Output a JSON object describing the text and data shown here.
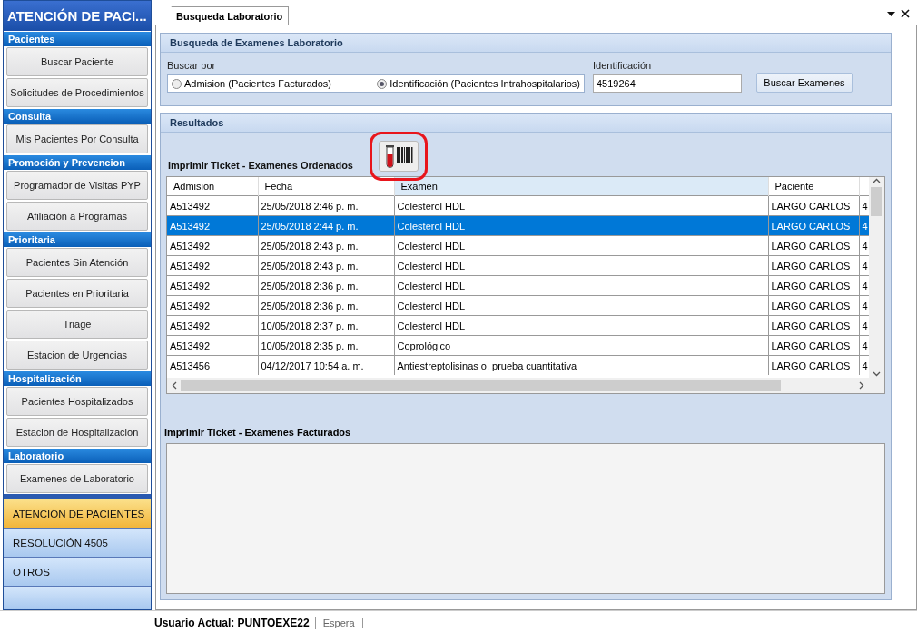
{
  "sidebar": {
    "title": "ATENCIÓN DE PACI...",
    "groups": [
      {
        "header": "Pacientes",
        "items": [
          "Buscar Paciente",
          "Solicitudes de Procedimientos"
        ]
      },
      {
        "header": "Consulta",
        "items": [
          "Mis Pacientes Por Consulta"
        ]
      },
      {
        "header": "Promoción y Prevencion",
        "items": [
          "Programador de Visitas PYP",
          "Afiliación a Programas"
        ]
      },
      {
        "header": "Prioritaria",
        "items": [
          "Pacientes Sin Atención",
          "Pacientes en Prioritaria",
          "Triage",
          "Estacion de Urgencias"
        ]
      },
      {
        "header": "Hospitalización",
        "items": [
          "Pacientes Hospitalizados",
          "Estacion de Hospitalizacion"
        ]
      },
      {
        "header": "Laboratorio",
        "items": [
          "Examenes de Laboratorio"
        ]
      }
    ],
    "modules": [
      {
        "label": "ATENCIÓN DE PACIENTES",
        "selected": true
      },
      {
        "label": "RESOLUCIÓN 4505",
        "selected": false
      },
      {
        "label": "OTROS",
        "selected": false
      }
    ]
  },
  "tabs": [
    {
      "label": "Busqueda Laboratorio",
      "selected": true
    }
  ],
  "search": {
    "title": "Busqueda de Examenes Laboratorio",
    "search_by_label": "Buscar por",
    "options": [
      {
        "label": "Admision (Pacientes Facturados)",
        "selected": false
      },
      {
        "label": "Identificación (Pacientes Intrahospitalarios)",
        "selected": true
      }
    ],
    "id_label": "Identificación",
    "id_value": "4519264",
    "button": "Buscar Examenes"
  },
  "results": {
    "title": "Resultados",
    "ordered_title": "Imprimir Ticket - Examenes Ordenados",
    "table": {
      "columns": [
        "Admision",
        "Fecha",
        "Examen",
        "Paciente"
      ],
      "rows": [
        {
          "cells": [
            "A513492",
            "25/05/2018 2:46 p. m.",
            "Colesterol HDL",
            "LARGO  CARLOS",
            "4"
          ],
          "selected": false
        },
        {
          "cells": [
            "A513492",
            "25/05/2018 2:44 p. m.",
            "Colesterol HDL",
            "LARGO  CARLOS",
            "4"
          ],
          "selected": true
        },
        {
          "cells": [
            "A513492",
            "25/05/2018 2:43 p. m.",
            "Colesterol HDL",
            "LARGO  CARLOS",
            "4"
          ],
          "selected": false
        },
        {
          "cells": [
            "A513492",
            "25/05/2018 2:43 p. m.",
            "Colesterol HDL",
            "LARGO  CARLOS",
            "4"
          ],
          "selected": false
        },
        {
          "cells": [
            "A513492",
            "25/05/2018 2:36 p. m.",
            "Colesterol HDL",
            "LARGO  CARLOS",
            "4"
          ],
          "selected": false
        },
        {
          "cells": [
            "A513492",
            "25/05/2018 2:36 p. m.",
            "Colesterol HDL",
            "LARGO  CARLOS",
            "4"
          ],
          "selected": false
        },
        {
          "cells": [
            "A513492",
            "10/05/2018 2:37 p. m.",
            "Colesterol HDL",
            "LARGO  CARLOS",
            "4"
          ],
          "selected": false
        },
        {
          "cells": [
            "A513492",
            "10/05/2018 2:35 p. m.",
            "Coprológico",
            "LARGO  CARLOS",
            "4"
          ],
          "selected": false
        },
        {
          "cells": [
            "A513456",
            "04/12/2017 10:54 a. m.",
            "Antiestreptolisinas o. prueba cuantitativa",
            "LARGO  CARLOS",
            "4"
          ],
          "selected": false
        }
      ]
    },
    "billed_title": "Imprimir Ticket - Examenes Facturados"
  },
  "status_bar": {
    "user": "Usuario Actual: PUNTOEXE22",
    "state": "Espera"
  }
}
